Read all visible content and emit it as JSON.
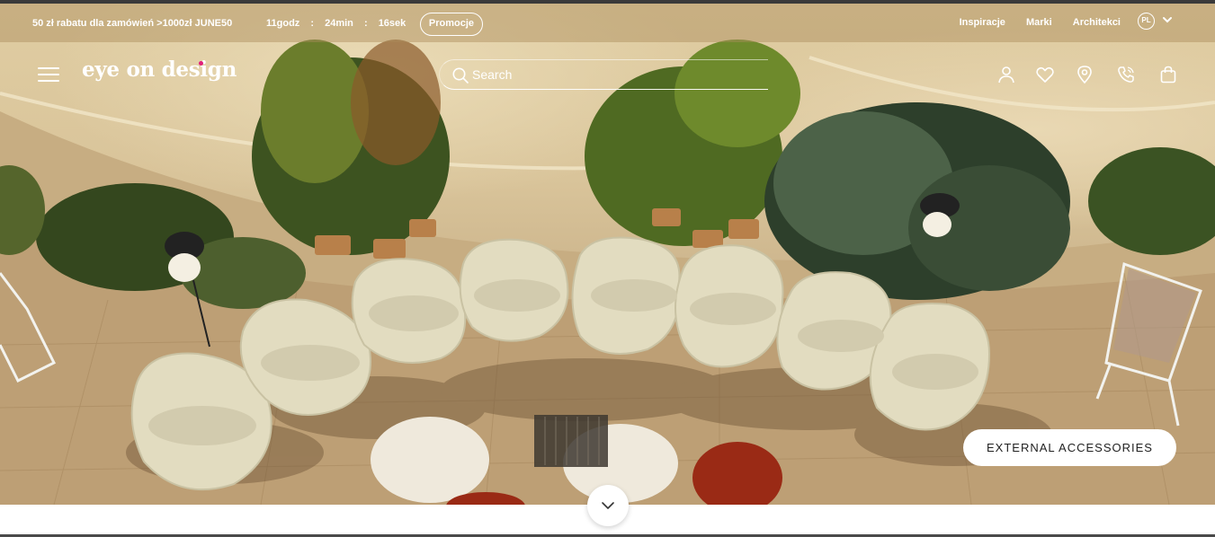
{
  "announcement": {
    "promo_text": "50 zł rabatu dla zamówień >1000zł JUNE50",
    "countdown": {
      "hours": "11godz",
      "minutes": "24min",
      "seconds": "16sek",
      "separator": ":"
    },
    "promo_button": "Promocje"
  },
  "top_links": [
    "Inspiracje",
    "Marki",
    "Architekci"
  ],
  "language": {
    "selected": "PL",
    "icon": "chevron-down-icon"
  },
  "header": {
    "logo_text": "eye on design",
    "menu_icon": "hamburger-menu-icon",
    "search": {
      "placeholder": "Search",
      "value": ""
    },
    "icons": [
      "account-icon",
      "wishlist-heart-icon",
      "store-location-icon",
      "phone-icon",
      "cart-bag-icon"
    ]
  },
  "hero": {
    "cta_label": "EXTERNAL ACCESSORIES",
    "scroll_icon": "chevron-down-icon"
  },
  "colors": {
    "logo_dot": "#e0207a",
    "header_text": "#ffffff",
    "cta_background": "#ffffff"
  }
}
